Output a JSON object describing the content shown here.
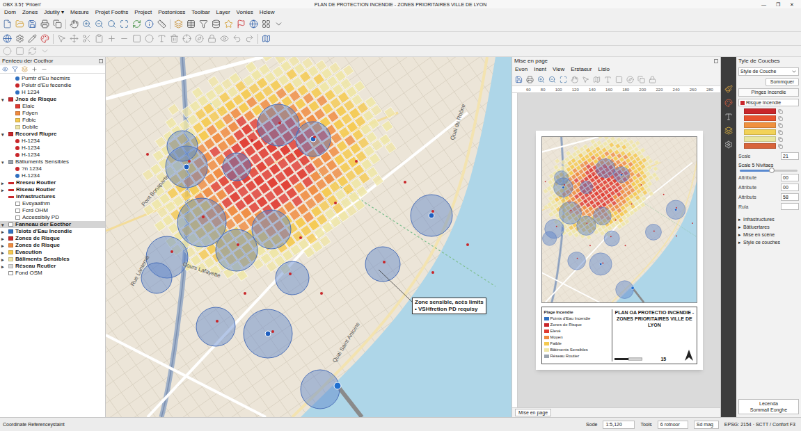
{
  "window": {
    "app": "OBX 3.5† 'Prioen'",
    "title": "PLAN DE PROTECTION INCENDIE - ZONES PRIORITAIRES VILLE DE LYON",
    "controls": [
      "—",
      "❐",
      "✕"
    ]
  },
  "menu": [
    "Dom",
    "Zones",
    "Jdutliy ▾",
    "Mesure",
    "Projet Fooths",
    "Project",
    "Postonioss",
    "Toolbar",
    "Layer",
    "Vonies",
    "Hclew"
  ],
  "layers_panel": {
    "title": "Fenteeu der Cocthor",
    "items": [
      {
        "label": "Pumtr d'Eu hecmirs",
        "toggle": "",
        "indent": 1,
        "kind": "dot",
        "color": "#2f6fc0",
        "bold": false,
        "selected": false
      },
      {
        "label": "Polutr d'Eu fecendie",
        "toggle": "",
        "indent": 1,
        "kind": "dot",
        "color": "#c8262a",
        "bold": false,
        "selected": false
      },
      {
        "label": "H 1234",
        "toggle": "",
        "indent": 1,
        "kind": "dot",
        "color": "#2f6fc0",
        "bold": false,
        "selected": false
      },
      {
        "label": "Jnos de Risque",
        "toggle": "▾",
        "indent": 0,
        "kind": "square",
        "color": "#c8262a",
        "bold": true,
        "selected": false
      },
      {
        "label": "Elaic",
        "toggle": "",
        "indent": 1,
        "kind": "zone",
        "color": "#e0392f",
        "bold": false,
        "selected": false
      },
      {
        "label": "Fdyen",
        "toggle": "",
        "indent": 1,
        "kind": "zone",
        "color": "#f08a3e",
        "bold": false,
        "selected": false
      },
      {
        "label": "Fdbic",
        "toggle": "",
        "indent": 1,
        "kind": "zone",
        "color": "#f5c94e",
        "bold": false,
        "selected": false
      },
      {
        "label": "Dobile",
        "toggle": "",
        "indent": 1,
        "kind": "zone",
        "color": "#efe6a6",
        "bold": false,
        "selected": false
      },
      {
        "label": "Recorvd Riupre",
        "toggle": "▾",
        "indent": 0,
        "kind": "square",
        "color": "#c8262a",
        "bold": true,
        "selected": false
      },
      {
        "label": "H-1234",
        "toggle": "",
        "indent": 1,
        "kind": "dot",
        "color": "#c8262a",
        "bold": false,
        "selected": false
      },
      {
        "label": "H-1234",
        "toggle": "",
        "indent": 1,
        "kind": "dot",
        "color": "#c8262a",
        "bold": false,
        "selected": false
      },
      {
        "label": "H-1234",
        "toggle": "",
        "indent": 1,
        "kind": "dot",
        "color": "#c8262a",
        "bold": false,
        "selected": false
      },
      {
        "label": "Bâtiuments Sensibles",
        "toggle": "▾",
        "indent": 0,
        "kind": "square",
        "color": "#9aa3ad",
        "bold": false,
        "selected": false
      },
      {
        "label": "?n 1234",
        "toggle": "",
        "indent": 1,
        "kind": "dot",
        "color": "#c8262a",
        "bold": false,
        "selected": false
      },
      {
        "label": "H-1234",
        "toggle": "",
        "indent": 1,
        "kind": "dot",
        "color": "#2f6fc0",
        "bold": false,
        "selected": false
      },
      {
        "label": "Rreseu Routler",
        "toggle": "▸",
        "indent": 0,
        "kind": "line",
        "color": "#c8262a",
        "bold": true,
        "selected": false
      },
      {
        "label": "Riseau Routier",
        "toggle": "▸",
        "indent": 0,
        "kind": "line",
        "color": "#c8262a",
        "bold": true,
        "selected": false
      },
      {
        "label": "Infrastructures",
        "toggle": "",
        "indent": 0,
        "kind": "line",
        "color": "#c8262a",
        "bold": true,
        "selected": false
      },
      {
        "label": "Evsyaathrn",
        "toggle": "",
        "indent": 1,
        "kind": "plain",
        "color": "#ffffff",
        "bold": false,
        "selected": false
      },
      {
        "label": "Fcrd OHM",
        "toggle": "",
        "indent": 1,
        "kind": "plain",
        "color": "#ffffff",
        "bold": false,
        "selected": false
      },
      {
        "label": "Accessibily PD",
        "toggle": "",
        "indent": 1,
        "kind": "plain",
        "color": "#ffffff",
        "bold": false,
        "selected": false
      },
      {
        "label": "Fanneau der Eocthor",
        "toggle": "▾",
        "indent": 0,
        "kind": "plain",
        "color": "#ffffff",
        "bold": true,
        "selected": true
      },
      {
        "label": "Tsiots d'Eau Incendie",
        "toggle": "▸",
        "indent": 0,
        "kind": "square",
        "color": "#2f6fc0",
        "bold": true,
        "selected": false
      },
      {
        "label": "Zones de Risque",
        "toggle": "▸",
        "indent": 0,
        "kind": "square",
        "color": "#c8262a",
        "bold": true,
        "selected": false
      },
      {
        "label": "Zones de Risque",
        "toggle": "▸",
        "indent": 0,
        "kind": "square",
        "color": "#f08a3e",
        "bold": true,
        "selected": false
      },
      {
        "label": "Evacution",
        "toggle": "▸",
        "indent": 0,
        "kind": "square",
        "color": "#f5c94e",
        "bold": true,
        "selected": false
      },
      {
        "label": "Bâliments Sensibles",
        "toggle": "▸",
        "indent": 0,
        "kind": "square",
        "color": "#efe6a6",
        "bold": true,
        "selected": false
      },
      {
        "label": "Réseau Reutier",
        "toggle": "▸",
        "indent": 0,
        "kind": "square",
        "color": "#d9d9d9",
        "bold": true,
        "selected": false
      },
      {
        "label": "Fond OSM",
        "toggle": "",
        "indent": 0,
        "kind": "plain",
        "color": "#ffffff",
        "bold": false,
        "selected": false
      }
    ]
  },
  "map": {
    "labels": [
      "Rue Lanterne",
      "Quai Saint Antoine",
      "Cours Lafayette",
      "Quai du Rhône",
      "Pont Bonaparte"
    ],
    "callout": [
      "Zone sensible, acès limits",
      "• VSHfretion PD requisy"
    ]
  },
  "layout": {
    "title": "Mise en page",
    "menu": [
      "Evon",
      "Inent",
      "View",
      "Erstaeur",
      "Lislo"
    ],
    "ruler": [
      "60",
      "80",
      "100",
      "120",
      "140",
      "160",
      "180",
      "200",
      "220",
      "240",
      "260",
      "280"
    ],
    "page": {
      "legend_title": "Plage Incendie",
      "title": "PLAN OA PROTECTIO INCENDIE - ZONES PRIORITAIRES VILLE DE LYON",
      "scale": "15",
      "legend": [
        {
          "label": "Points d'Eau Incendie",
          "color": "#2f6fc0"
        },
        {
          "label": "Zones de Risque",
          "color": "#c8262a"
        },
        {
          "label": "Elevé",
          "color": "#e0392f"
        },
        {
          "label": "Moyen",
          "color": "#f08a3e"
        },
        {
          "label": "Faible",
          "color": "#f5c94e"
        },
        {
          "label": "Bâtiments Sensibles",
          "color": "#efe6a6"
        },
        {
          "label": "Réseau Routier",
          "color": "#9aa3ad"
        }
      ]
    },
    "tab": "Mise en page"
  },
  "style_panel": {
    "title": "Tyle de Coucbes",
    "dropdown": "Style de Couche",
    "button": "Sommquer",
    "subtitle": "Pinges Incendie",
    "ramp_select": "Risque Incendie",
    "ramp": [
      {
        "color": "#c8262a"
      },
      {
        "color": "#e8532e"
      },
      {
        "color": "#f0913e"
      },
      {
        "color": "#f2d258"
      },
      {
        "color": "#e8e6a0"
      },
      {
        "color": "#d8643a"
      }
    ],
    "fields": [
      {
        "label": "Scale",
        "kind": "input",
        "value": "21",
        "level": 0
      },
      {
        "label": "Scale 5 Nivitaes",
        "kind": "slider",
        "value": "",
        "level": 0.55
      },
      {
        "label": "Attribute",
        "kind": "input",
        "value": "00",
        "level": 0
      },
      {
        "label": "Attribute",
        "kind": "input",
        "value": "00",
        "level": 0
      },
      {
        "label": "Attributs",
        "kind": "input",
        "value": "58",
        "level": 0
      },
      {
        "label": "Rula",
        "kind": "input",
        "value": "",
        "level": 0
      }
    ],
    "sections": [
      {
        "toggle": "▸",
        "label": "Infrastructures"
      },
      {
        "toggle": "▸",
        "label": "Bâtiuertares"
      },
      {
        "toggle": "▸",
        "label": "Mise en scène"
      },
      {
        "toggle": "▸",
        "label": "Style ce couches"
      }
    ],
    "footer": [
      "Lecenda",
      "Sommail Eonghe"
    ]
  },
  "status": {
    "crs": "Coordinate Referenceystaint",
    "scale_label": "Sode",
    "scale": "1:5,120",
    "tools": "Tools",
    "rotation": "6 rotnoor",
    "mag": "Sd mag",
    "epsg": "EPSG: 2154 · SCTT / Confort F3"
  }
}
